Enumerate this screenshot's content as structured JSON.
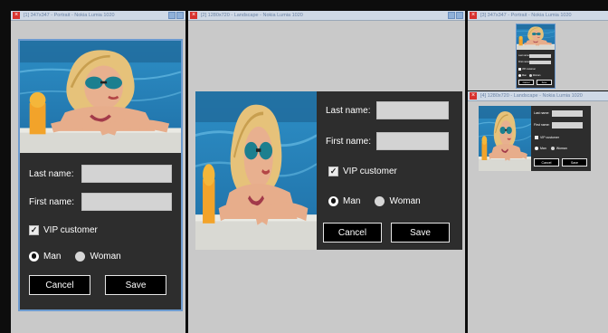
{
  "windows": [
    {
      "title": "[1] 347x347 - Portrait - Nokia Lumia 1020"
    },
    {
      "title": "[2] 1280x720 - Landscape - Nokia Lumia 1020"
    },
    {
      "title": "[3] 347x347 - Portrait - Nokia Lumia 1020"
    },
    {
      "title": "[4] 1280x720 - Landscape - Nokia Lumia 1020"
    }
  ],
  "form": {
    "last_name_label": "Last name:",
    "first_name_label": "First name:",
    "last_name_value": "",
    "first_name_value": "",
    "vip_label": "VIP customer",
    "vip_checked": true,
    "man_label": "Man",
    "woman_label": "Woman",
    "gender_selected": "Man",
    "cancel_label": "Cancel",
    "save_label": "Save"
  },
  "icons": {
    "close": "close-icon",
    "checkbox": "checkmark-icon",
    "title_buttons": "window-buttons-icon"
  },
  "colors": {
    "app_bg": "#2d2d2d",
    "textbox": "#d3d3d3",
    "window_bg": "#c9c9c9",
    "titlebar": "#cfd9e6",
    "close": "#d8322e",
    "button_bg": "#000000"
  }
}
